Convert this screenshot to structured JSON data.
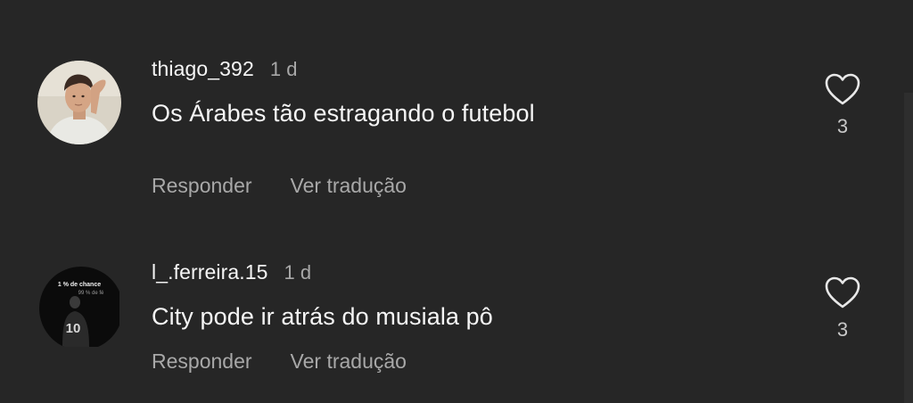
{
  "comments": [
    {
      "username": "thiago_392",
      "time": "1 d",
      "text": "Os Árabes tão estragando o futebol",
      "reply_label": "Responder",
      "translate_label": "Ver tradução",
      "likes": "3",
      "avatar_icon": "profile-photo"
    },
    {
      "username": "l_.ferreira.15",
      "time": "1 d",
      "text": "City pode ir atrás do musiala pô",
      "reply_label": "Responder",
      "translate_label": "Ver tradução",
      "likes": "3",
      "avatar_icon": "profile-photo",
      "avatar_caption_1": "1 % de chance",
      "avatar_caption_2": "99 % de fé",
      "avatar_number": "10"
    }
  ],
  "colors": {
    "background": "#262626",
    "primary_text": "#f5f5f5",
    "secondary_text": "#a8a8a8",
    "like_count": "#c8c8c8"
  }
}
